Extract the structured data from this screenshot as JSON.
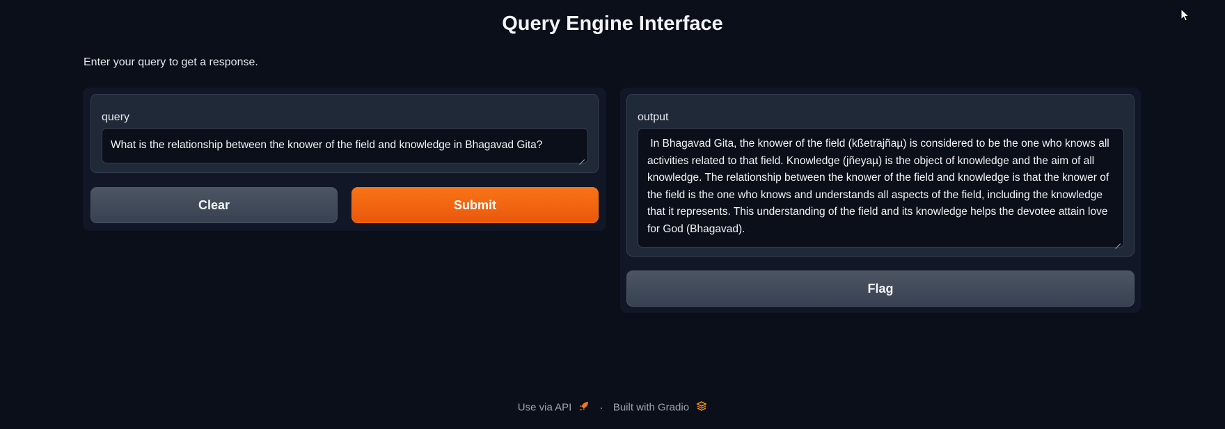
{
  "header": {
    "title": "Query Engine Interface",
    "description": "Enter your query to get a response."
  },
  "query": {
    "label": "query",
    "value": "What is the relationship between the knower of the field and knowledge in Bhagavad Gita?"
  },
  "buttons": {
    "clear_label": "Clear",
    "submit_label": "Submit",
    "flag_label": "Flag"
  },
  "output": {
    "label": "output",
    "value": " In Bhagavad Gita, the knower of the field (kßetrajñaµ) is considered to be the one who knows all activities related to that field. Knowledge (jñeyaµ) is the object of knowledge and the aim of all knowledge. The relationship between the knower of the field and knowledge is that the knower of the field is the one who knows and understands all aspects of the field, including the knowledge that it represents. This understanding of the field and its knowledge helps the devotee attain love for God (Bhagavad)."
  },
  "footer": {
    "api_link": "Use via API",
    "api_icon": "rocket-icon",
    "separator": "·",
    "built_with": "Built with Gradio",
    "gradio_icon": "gradio-logo-icon"
  },
  "colors": {
    "background": "#0b0f19",
    "panel": "#1f2937",
    "primary": "#f97316",
    "secondary": "#4b5563"
  }
}
